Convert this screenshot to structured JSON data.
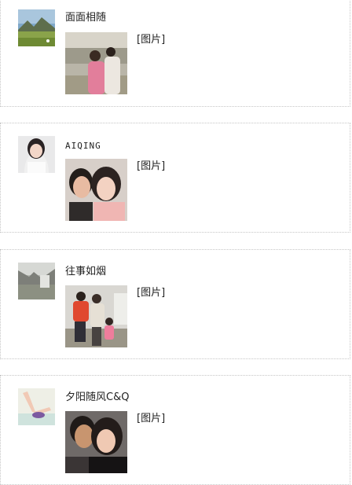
{
  "posts": [
    {
      "author": "面面相随",
      "content_text": "[图片]",
      "avatar_icon": "landscape-avatar",
      "photo_icon": "couple-outdoor-photo"
    },
    {
      "author": "AIQING",
      "content_text": "[图片]",
      "avatar_icon": "woman-portrait-avatar",
      "photo_icon": "couple-selfie-photo"
    },
    {
      "author": "往事如烟",
      "content_text": "[图片]",
      "avatar_icon": "street-scene-avatar",
      "photo_icon": "family-group-photo"
    },
    {
      "author": "夕阳随风C&Q",
      "content_text": "[图片]",
      "avatar_icon": "yoga-pose-avatar",
      "photo_icon": "couple-kiss-photo"
    }
  ]
}
